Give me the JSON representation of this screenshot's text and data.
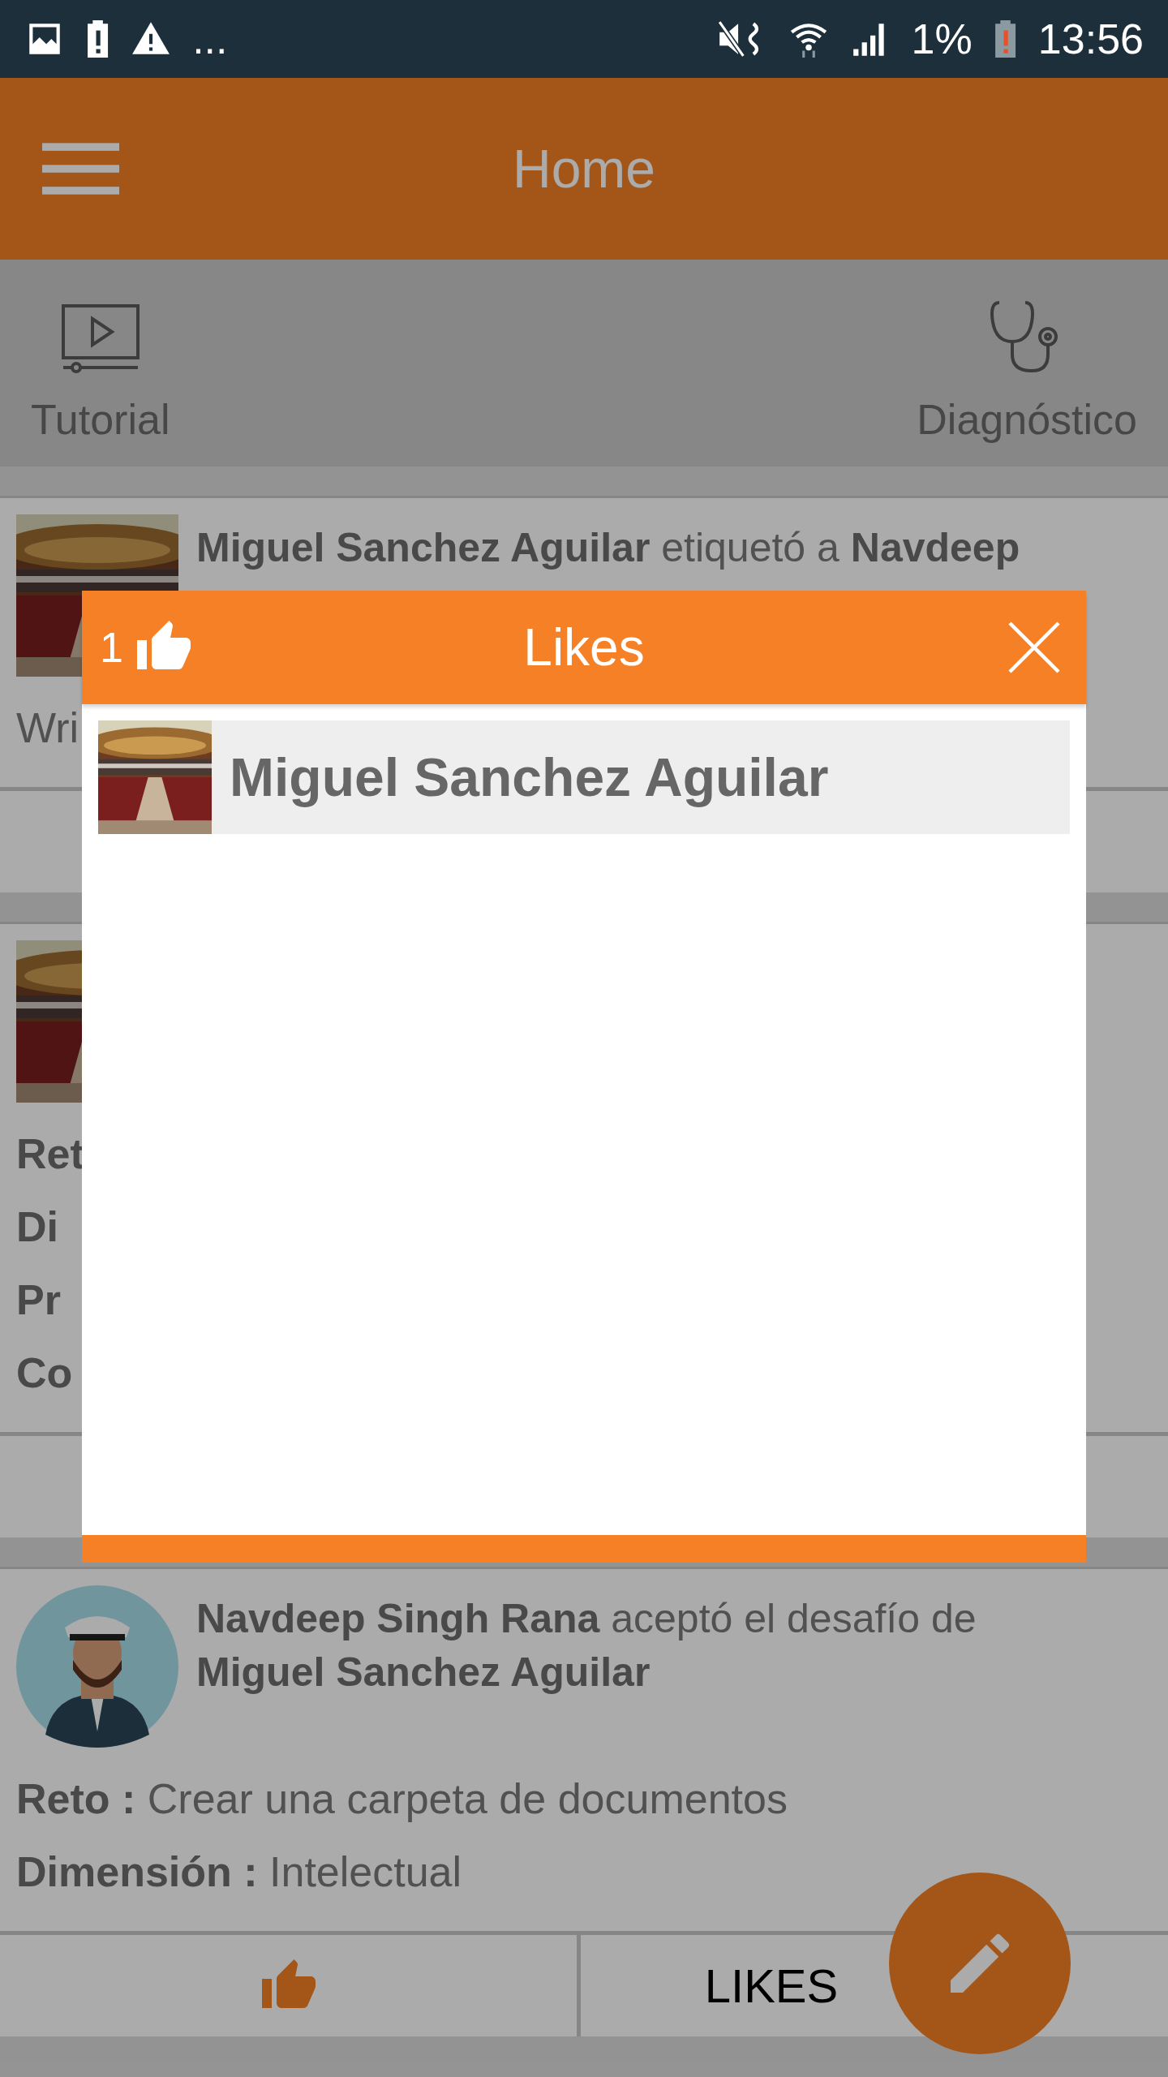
{
  "status_bar": {
    "more": "...",
    "battery": "1%",
    "time": "13:56"
  },
  "app_bar": {
    "title": "Home"
  },
  "shortcuts": [
    {
      "kind": "video",
      "label": "Tutorial"
    },
    {
      "kind": "stethoscope",
      "label": "Diagnóstico"
    }
  ],
  "posts": [
    {
      "avatar": {
        "kind": "picture"
      },
      "headline": "**Miguel Sanchez Aguilar** etiquetó a **Navdeep**",
      "lines": [
        {
          "value": "Wri"
        }
      ]
    },
    {
      "avatar": {
        "kind": "picture"
      },
      "lines": [
        {
          "label": "Ret"
        },
        {
          "label": "Di"
        },
        {
          "label": "Pr"
        },
        {
          "label": "Co"
        }
      ]
    },
    {
      "avatar": {
        "kind": "figure"
      },
      "headline": "**Navdeep Singh Rana** aceptó el desafío de **Miguel Sanchez Aguilar**",
      "lines": [
        {
          "label": "Reto :",
          "value": "Crear una carpeta de documentos"
        },
        {
          "label": "Dimensión :",
          "value": "Intelectual"
        }
      ],
      "likes_button": "LIKES"
    }
  ],
  "dialog": {
    "like_count": "1",
    "title": "Likes",
    "likers": [
      {
        "name": "Miguel Sanchez Aguilar"
      }
    ]
  }
}
